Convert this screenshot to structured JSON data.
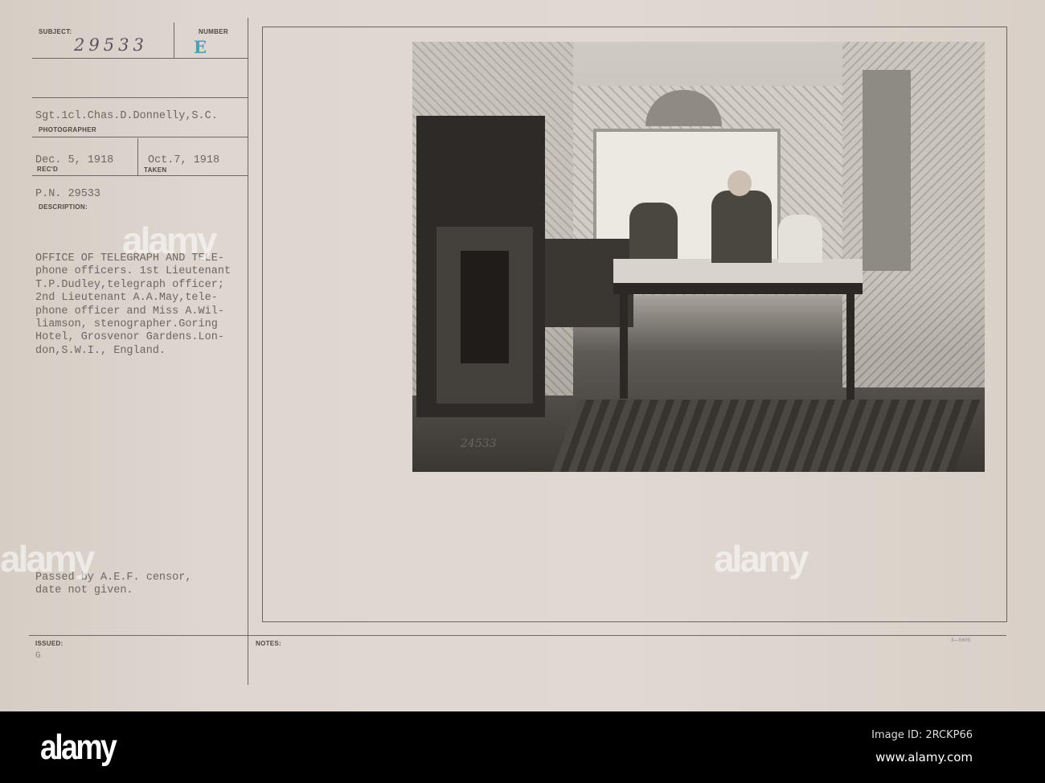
{
  "card": {
    "subject_label": "SUBJECT:",
    "subject_value": "29533",
    "number_label": "NUMBER",
    "number_value": "E",
    "photographer": "Sgt.1cl.Chas.D.Donnelly,S.C.",
    "photographer_label": "PHOTOGRAPHER",
    "received_date": "Dec. 5, 1918",
    "received_label": "REC'D",
    "taken_date": "Oct.7, 1918",
    "taken_label": "TAKEN",
    "pn": "P.N. 29533",
    "description_label": "DESCRIPTION:",
    "description": "OFFICE OF TELEGRAPH AND TELE-\nphone officers. 1st Lieutenant\nT.P.Dudley,telegraph officer;\n2nd Lieutenant A.A.May,tele-\nphone officer and Miss A.Wil-\nliamson, stenographer.Goring\nHotel, Grosvenor Gardens.Lon-\ndon,S.W.I., England.",
    "censor_note": "Passed by A.E.F. censor,\ndate not given.",
    "issued_label": "ISSUED:",
    "issued_value": "G",
    "notes_label": "NOTES:",
    "form_number": "3—5605",
    "photo_number": "24533"
  },
  "watermark": {
    "logo": "alamy",
    "image_id": "Image ID: 2RCKP66",
    "url": "www.alamy.com"
  }
}
